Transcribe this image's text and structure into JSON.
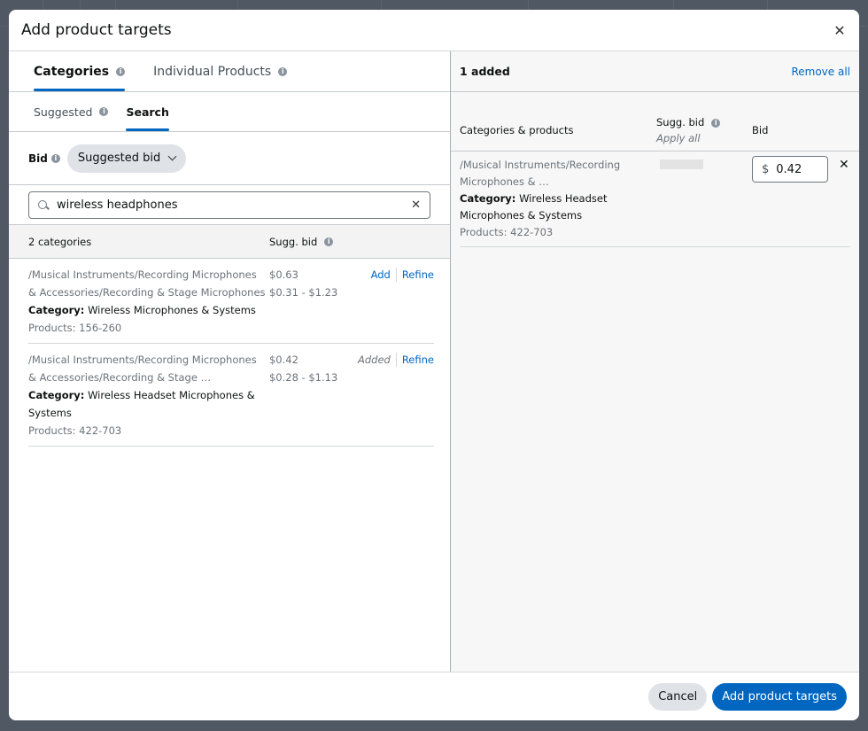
{
  "modal": {
    "title": "Add product targets",
    "close_icon": "close-icon"
  },
  "tabs": [
    {
      "label": "Categories",
      "active": true,
      "info": true
    },
    {
      "label": "Individual Products",
      "active": false,
      "info": true
    }
  ],
  "subtabs": [
    {
      "label": "Suggested",
      "active": false,
      "info": true
    },
    {
      "label": "Search",
      "active": true,
      "info": false
    }
  ],
  "bid": {
    "label": "Bid",
    "dropdown_value": "Suggested bid"
  },
  "search": {
    "value": "wireless headphones",
    "placeholder": ""
  },
  "results_header": {
    "count_label": "2 categories",
    "sugg_bid_label": "Sugg. bid"
  },
  "results": [
    {
      "path_line1": "/Musical Instruments/Recording Microphones",
      "path_line2": "& Accessories/Recording & Stage Microphones",
      "category_label": "Category:",
      "category_value": "Wireless Microphones & Systems",
      "products": "Products: 156-260",
      "sugg_bid": "$0.63",
      "sugg_range": "$0.31 - $1.23",
      "action": "Add",
      "action_state": "add",
      "refine": "Refine"
    },
    {
      "path_line1": "/Musical Instruments/Recording Microphones",
      "path_line2": "& Accessories/Recording & Stage …",
      "category_label": "Category:",
      "category_value": "Wireless Headset Microphones & Systems",
      "products": "Products: 422-703",
      "sugg_bid": "$0.42",
      "sugg_range": "$0.28 - $1.13",
      "action": "Added",
      "action_state": "added",
      "refine": "Refine"
    }
  ],
  "selected": {
    "count_label": "1 added",
    "remove_all": "Remove all",
    "col_categories": "Categories & products",
    "col_sugg_bid": "Sugg. bid",
    "col_sugg_sub": "Apply all",
    "col_bid": "Bid",
    "items": [
      {
        "path_line1": "/Musical Instruments/Recording",
        "path_line2": "Microphones & …",
        "category_label": "Category:",
        "category_value": "Wireless Headset Microphones & Systems",
        "products": "Products: 422-703",
        "currency": "$",
        "bid_value": "0.42"
      }
    ]
  },
  "footer": {
    "cancel_label": "Cancel",
    "submit_label": "Add product targets"
  },
  "colors": {
    "primary": "#0066c0",
    "overlay": "#4f5863",
    "secondary_button": "#dfe3e8"
  }
}
